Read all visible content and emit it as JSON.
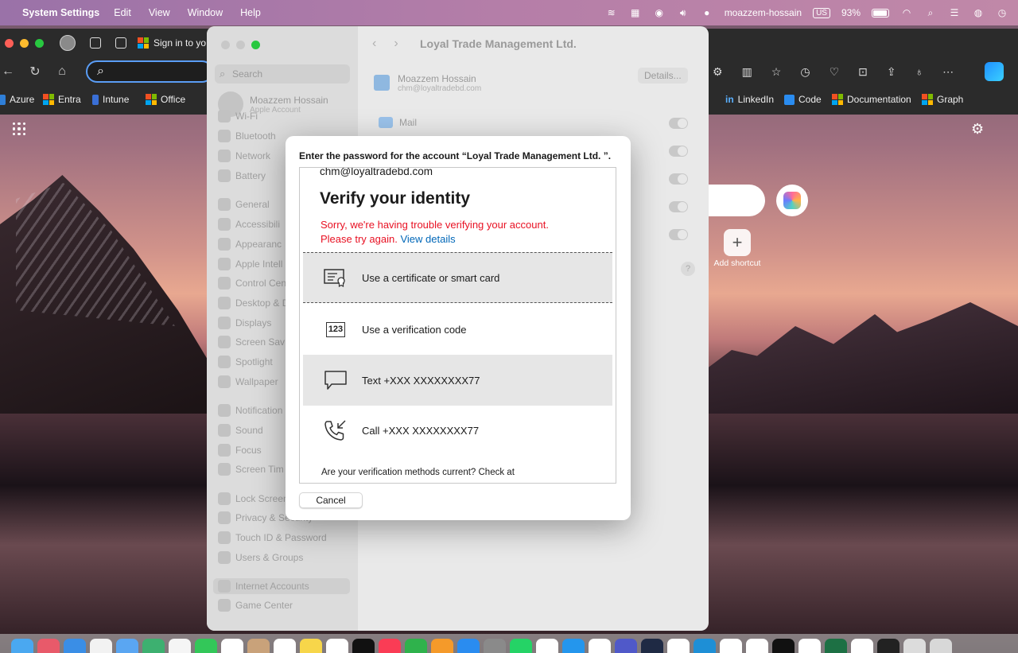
{
  "menubar": {
    "app_name": "System Settings",
    "menus": [
      "Edit",
      "View",
      "Window",
      "Help"
    ],
    "username": "moazzem-hossain",
    "input_source": "US",
    "battery": "93%"
  },
  "browser": {
    "tab_title": "Sign in to yo",
    "address_value": "",
    "bookmarks_left": [
      {
        "label": "Azure",
        "color": "#2f7fd8"
      },
      {
        "label": "Entra",
        "color": "#f25022"
      },
      {
        "label": "Intune",
        "color": "#3a6fd6"
      },
      {
        "label": "Office",
        "color": "#f25022"
      }
    ],
    "bookmarks_right": [
      {
        "label": "LinkedIn",
        "color": "#0a66c2"
      },
      {
        "label": "Code",
        "color": "#2a8cf0"
      },
      {
        "label": "Documentation",
        "color": "#f25022"
      },
      {
        "label": "Graph",
        "color": "#f25022"
      }
    ],
    "add_shortcut_label": "Add shortcut"
  },
  "settings": {
    "search_placeholder": "Search",
    "account_name": "Moazzem Hossain",
    "account_sub": "Apple Account",
    "sidebar_items": [
      "Wi-Fi",
      "Bluetooth",
      "Network",
      "Battery",
      "General",
      "Accessibili",
      "Appearanc",
      "Apple Intell",
      "Control Cen",
      "Desktop & D",
      "Displays",
      "Screen Sav",
      "Spotlight",
      "Wallpaper",
      "Notification",
      "Sound",
      "Focus",
      "Screen Tim",
      "Lock Screen",
      "Privacy & Security",
      "Touch ID & Password",
      "Users & Groups",
      "Internet Accounts",
      "Game Center"
    ],
    "title": "Loyal Trade Management Ltd.",
    "user_name": "Moazzem Hossain",
    "user_email": "chm@loyaltradebd.com",
    "details_label": "Details...",
    "mail_label": "Mail",
    "help": "?"
  },
  "dialog": {
    "prompt": "Enter the password for the account “Loyal Trade Management Ltd. ”.",
    "email": "chm@loyaltradebd.com",
    "heading": "Verify your identity",
    "error_line1": "Sorry, we're having trouble verifying your account.",
    "error_line2": "Please try again.",
    "error_link": "View details",
    "options": [
      {
        "label": "Use a certificate or smart card",
        "icon": "certificate-icon"
      },
      {
        "label": "Use a verification code",
        "icon": "code-icon",
        "badge": "123"
      },
      {
        "label": "Text +XXX XXXXXXXX77",
        "icon": "message-icon"
      },
      {
        "label": "Call +XXX XXXXXXXX77",
        "icon": "phone-icon"
      }
    ],
    "footer": "Are your verification methods current? Check at",
    "cancel_label": "Cancel"
  }
}
